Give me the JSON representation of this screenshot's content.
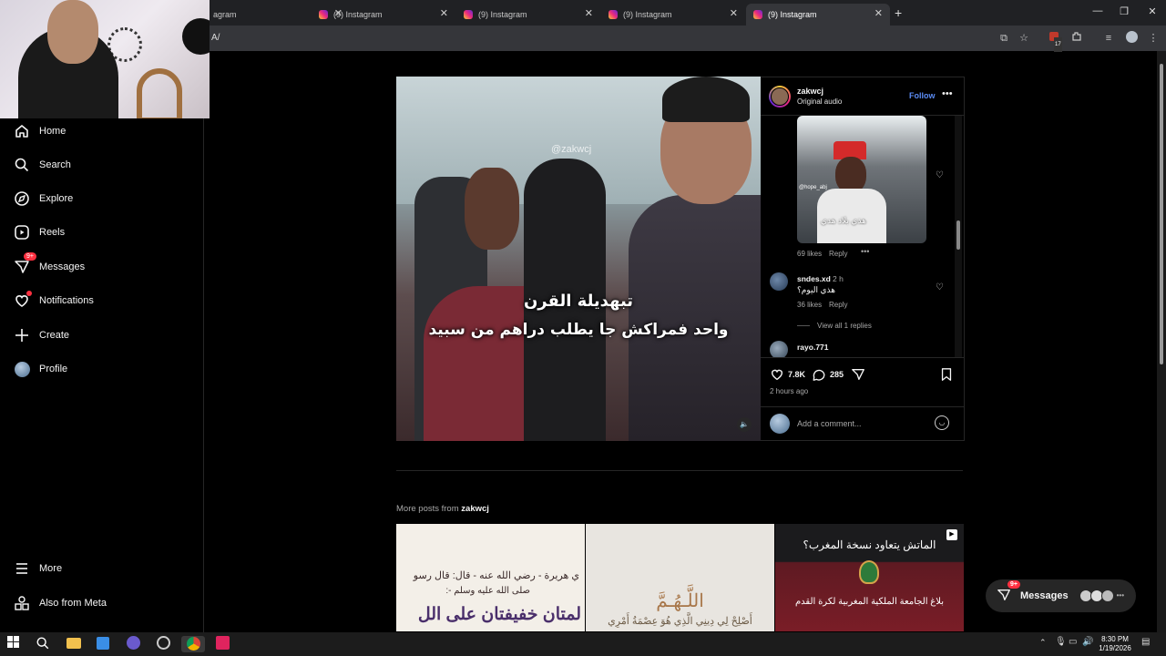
{
  "browser": {
    "tabs": [
      {
        "title": "agram",
        "active": false
      },
      {
        "title": "(9) Instagram",
        "active": false
      },
      {
        "title": "(9) Instagram",
        "active": false
      },
      {
        "title": "(9) Instagram",
        "active": false
      },
      {
        "title": "(9) Instagram",
        "active": true
      }
    ],
    "new_tab": "+",
    "url": "A/",
    "extension_badge": "17"
  },
  "sidebar": {
    "items": [
      {
        "label": "Home",
        "icon": "home-icon"
      },
      {
        "label": "Search",
        "icon": "search-icon"
      },
      {
        "label": "Explore",
        "icon": "explore-icon"
      },
      {
        "label": "Reels",
        "icon": "reels-icon"
      },
      {
        "label": "Messages",
        "icon": "messages-icon",
        "badge": "9+"
      },
      {
        "label": "Notifications",
        "icon": "heart-icon"
      },
      {
        "label": "Create",
        "icon": "plus-icon"
      },
      {
        "label": "Profile",
        "icon": "avatar"
      }
    ],
    "bottom": [
      {
        "label": "More",
        "icon": "menu-icon"
      },
      {
        "label": "Also from Meta",
        "icon": "meta-icon"
      }
    ]
  },
  "post": {
    "watermark": "@zakwcj",
    "caption_line1": "تبهديلة القرن",
    "caption_line2": "واحد فمراكش جا يطلب دراهم من سبيد",
    "username": "zakwcj",
    "audio": "Original audio",
    "follow": "Follow",
    "likes_count": "7.8K",
    "comments_count": "285",
    "time_ago": "2 hours ago",
    "add_comment_placeholder": "Add a comment..."
  },
  "comments": {
    "c1": {
      "image_caption": "هذي بلاد هدي",
      "image_tag": "@hope_abj",
      "likes": "69 likes",
      "reply": "Reply"
    },
    "c2": {
      "user": "sndes.xd",
      "time": "2 h",
      "text": "هذي اليوم؟",
      "likes": "36 likes",
      "reply": "Reply",
      "view_replies": "View all 1 replies"
    },
    "c3": {
      "user": "rayo.771"
    }
  },
  "more_posts": {
    "prefix": "More posts from ",
    "user": "zakwcj",
    "thumb1_lines": [
      "ي هريرة - رضي الله عنه - قال: قال رسو",
      "صلى الله عليه وسلم -:",
      "لمتان خفيفتان على الل"
    ],
    "thumb2_lines": [
      "اللَّـهُـمَّ",
      "أَصْلِحْ لِي دِينِي الَّذِي هُوَ عِصْمَةُ أَمْرِي"
    ],
    "thumb3_lines": [
      "الماتش يتعاود نسخة المغرب؟",
      "بلاغ الجامعة الملكية المغربية لكرة القدم"
    ]
  },
  "messages_pill": {
    "label": "Messages",
    "badge": "9+"
  },
  "taskbar": {
    "time": "8:30 PM",
    "date": "1/19/2026"
  }
}
